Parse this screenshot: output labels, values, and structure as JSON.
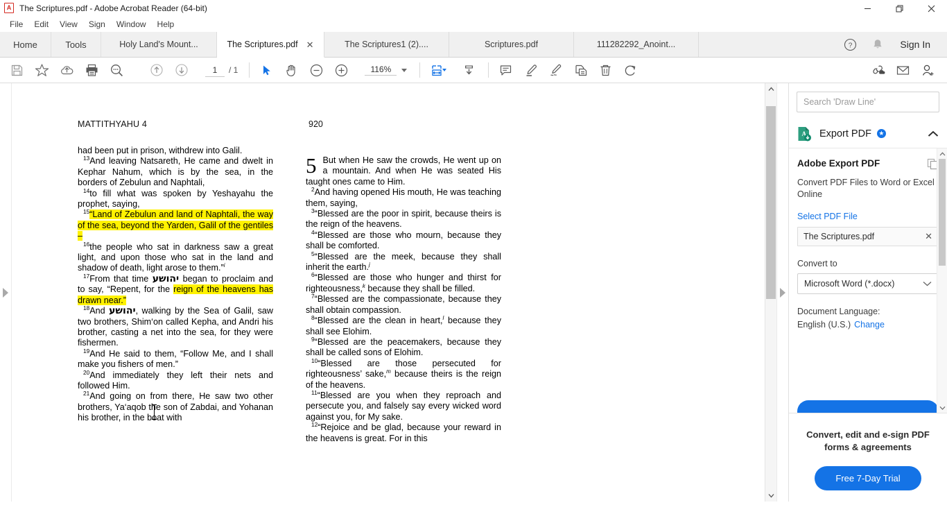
{
  "window": {
    "title": "The Scriptures.pdf - Adobe Acrobat Reader (64-bit)",
    "app_icon": "acrobat-icon",
    "minimize_label": "—",
    "maximize_label": "❐",
    "close_label": "✕"
  },
  "menubar": {
    "items": [
      {
        "label": "File"
      },
      {
        "label": "Edit"
      },
      {
        "label": "View"
      },
      {
        "label": "Sign"
      },
      {
        "label": "Window"
      },
      {
        "label": "Help"
      }
    ]
  },
  "tabbar": {
    "home_label": "Home",
    "tools_label": "Tools",
    "tabs": [
      {
        "label": "Holy Land's Mount...",
        "active": false,
        "closable": false
      },
      {
        "label": "The Scriptures.pdf",
        "active": true,
        "closable": true,
        "close_label": "✕"
      },
      {
        "label": "The Scriptures1 (2)....",
        "active": false,
        "closable": false
      },
      {
        "label": "Scriptures.pdf",
        "active": false,
        "closable": false
      },
      {
        "label": "111282292_Anoint...",
        "active": false,
        "closable": false
      }
    ],
    "help_icon": "help-circle-icon",
    "bell_icon": "bell-icon",
    "signin_label": "Sign In"
  },
  "toolbar": {
    "save_icon": "save-floppy-icon",
    "favorite_icon": "star-icon",
    "upload_icon": "cloud-upload-icon",
    "print_icon": "printer-icon",
    "find_icon": "search-magnifier-icon",
    "prev_page_icon": "arrow-up-circle-icon",
    "next_page_icon": "arrow-down-circle-icon",
    "page_number": "1",
    "page_total": "/ 1",
    "select_tool_icon": "cursor-arrow-icon",
    "hand_tool_icon": "hand-icon",
    "zoom_out_icon": "minus-circle-icon",
    "zoom_in_icon": "plus-circle-icon",
    "zoom_level": "116%",
    "zoom_dropdown_icon": "chevron-down-icon",
    "fit_page_icon": "fit-page-icon",
    "scroll_mode_icon": "scroll-mode-icon",
    "comment_icon": "comment-bubble-icon",
    "highlight_icon": "highlighter-icon",
    "draw_icon": "pen-draw-icon",
    "stamp_icon": "stamp-icon",
    "delete_icon": "trash-icon",
    "rotate_icon": "rotate-icon",
    "share_link_icon": "link-cloud-icon",
    "email_icon": "envelope-icon",
    "account_icon": "user-add-icon"
  },
  "navigation": {
    "left_panel_arrow_icon": "chevron-right-icon",
    "right_panel_arrow_icon": "chevron-right-icon"
  },
  "document": {
    "header_left": "MATTITHYAHU 4",
    "header_right": "920",
    "left_column": {
      "paragraphs": [
        {
          "id": "p-cont",
          "text": "had been put in prison, withdrew into Galil."
        },
        {
          "id": "p13",
          "verse": "13",
          "text": "And leaving Natsareth, He came and dwelt in Kephar Nahum, which is by the sea, in the borders of Zebulun and Naphtali,"
        },
        {
          "id": "p14",
          "verse": "14",
          "text": "to fill what was spoken by Yeshayahu the prophet, saying,"
        },
        {
          "id": "p15",
          "verse": "15",
          "highlighted": true,
          "text": "“Land of Zebulun and land of Naphtali, the way of the sea, beyond the Yarden, Galil of the gentiles –"
        },
        {
          "id": "p16",
          "verse": "16",
          "text": "the people who sat in darkness saw a great light, and upon those who sat in the land and shadow of death, light arose to them.”",
          "footnote": "i"
        },
        {
          "id": "p17",
          "verse": "17",
          "text_before": "From that time",
          "hebrew": "יהושע",
          "text_mid": "began to proclaim and to say, “Repent, for the",
          "highlight_text": "reign of the heavens has drawn near.”"
        },
        {
          "id": "p18",
          "verse": "18",
          "text_before": "And",
          "hebrew": "יהושע",
          "text_after": ", walking by the Sea of Galil, saw two brothers, Shim‘on called Kepha, and Andri his brother, casting a net into the sea, for they were fishermen."
        },
        {
          "id": "p19",
          "verse": "19",
          "text": "And He said to them, “Follow Me, and I shall make you fishers of men.”"
        },
        {
          "id": "p20",
          "verse": "20",
          "text": "And immediately they left their nets and followed Him."
        },
        {
          "id": "p21",
          "verse": "21",
          "text": "And going on from there, He saw two other brothers, Ya‘aqob the son  of Zabdai, and Yohanan his brother, in the boat with"
        }
      ]
    },
    "right_column": {
      "chapter_number": "5",
      "paragraphs": [
        {
          "id": "r1",
          "text": "But when He saw the crowds, He went up on a mountain. And when He was seated His taught ones came to Him."
        },
        {
          "id": "r2",
          "verse": "2",
          "text": "And having opened His mouth, He was teaching them, saying,"
        },
        {
          "id": "r3",
          "verse": "3",
          "text": "“Blessed are the poor in spirit, because theirs is the reign of the heavens."
        },
        {
          "id": "r4",
          "verse": "4",
          "text": "“Blessed are those who mourn, because they shall be comforted."
        },
        {
          "id": "r5",
          "verse": "5",
          "text": "“Blessed are the meek, because they shall inherit the earth.",
          "footnote": "j"
        },
        {
          "id": "r6",
          "verse": "6",
          "text_a": "“Blessed are those who hunger and thirst for righteousness,",
          "footnote": "k",
          "text_b": " because they shall be filled."
        },
        {
          "id": "r7",
          "verse": "7",
          "text": "“Blessed are the compassionate, because they shall obtain compassion."
        },
        {
          "id": "r8",
          "verse": "8",
          "text_a": "“Blessed are the clean in heart,",
          "footnote": "l",
          "text_b": " because they shall see Elohim."
        },
        {
          "id": "r9",
          "verse": "9",
          "text": "“Blessed are the peacemakers, because they shall be called sons of Elohim."
        },
        {
          "id": "r10",
          "verse": "10",
          "text_a": "“Blessed are those persecuted for righteousness’ sake,",
          "footnote": "m",
          "text_b": " because theirs is the reign of the heavens."
        },
        {
          "id": "r11",
          "verse": "11",
          "text": "“Blessed are you when they reproach and persecute you, and falsely say every wicked word against you, for My sake."
        },
        {
          "id": "r12",
          "verse": "12",
          "text": "“Rejoice and be glad, because your reward in the heavens is great. For in this"
        }
      ]
    },
    "highlight_color": "#fff200"
  },
  "right_panel": {
    "search_placeholder": "Search 'Draw Line'",
    "export_header": {
      "icon": "export-pdf-icon",
      "title": "Export PDF",
      "badge_icon": "premium-star-icon",
      "collapse_icon": "chevron-up-icon"
    },
    "section_title": "Adobe Export PDF",
    "copy_icon": "copy-documents-icon",
    "description": "Convert PDF Files to Word or Excel Online",
    "select_file_link": "Select PDF File",
    "selected_file": "The Scriptures.pdf",
    "clear_file_icon": "close-x-icon",
    "convert_to_label": "Convert to",
    "convert_to_value": "Microsoft Word (*.docx)",
    "convert_dropdown_icon": "chevron-down-icon",
    "document_language_label": "Document Language:",
    "document_language_value": "English (U.S.)",
    "change_link": "Change",
    "promo_text": "Convert, edit and e-sign PDF forms & agreements",
    "trial_button": "Free 7-Day Trial"
  },
  "colors": {
    "accent_blue": "#1473e6",
    "highlight_yellow": "#fff200",
    "toolbar_bg": "#ffffff",
    "tabbar_bg": "#f0f0f0",
    "selected_tool": "#1473e6"
  }
}
